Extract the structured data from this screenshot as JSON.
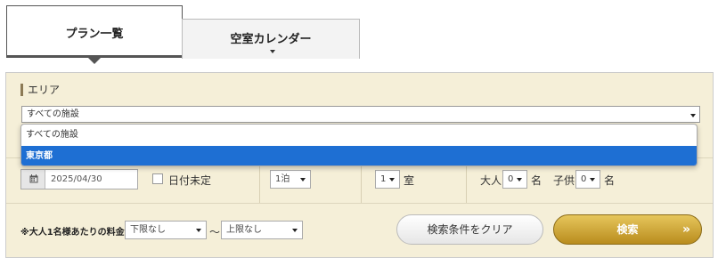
{
  "tabs": [
    {
      "label": "プラン一覧",
      "active": true
    },
    {
      "label": "空室カレンダー",
      "active": false
    }
  ],
  "area": {
    "label": "エリア",
    "selected": "すべての施設",
    "options": [
      "すべての施設",
      "東京都"
    ],
    "highlighted": "東京都"
  },
  "date": {
    "value": "2025/04/30",
    "undecided_label": "日付未定"
  },
  "nights": {
    "value": "1泊"
  },
  "rooms": {
    "value": "1",
    "unit": "室"
  },
  "guests": {
    "adult_label": "大人",
    "adult_value": "0",
    "adult_unit": "名",
    "child_label": "子供",
    "child_value": "0",
    "child_unit": "名"
  },
  "price": {
    "label": "※大人1名様あたりの料金",
    "min": "下限なし",
    "separator": "〜",
    "max": "上限なし"
  },
  "buttons": {
    "clear": "検索条件をクリア",
    "search": "検索",
    "search_arrow": "»"
  },
  "colors": {
    "panel_bg": "#f5efd8",
    "search_gold": "#c89b2a",
    "highlight_blue": "#1e6fd3"
  }
}
